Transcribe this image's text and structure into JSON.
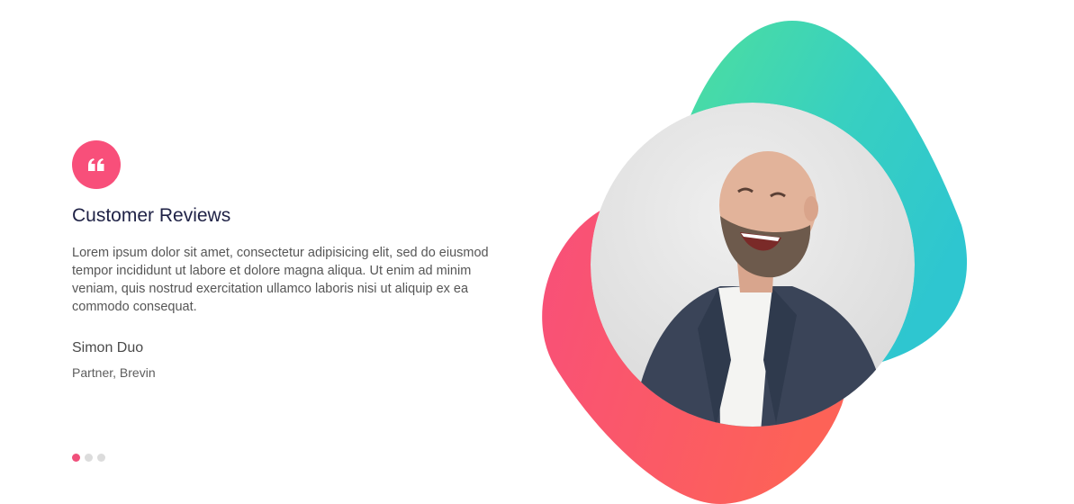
{
  "review": {
    "title": "Customer Reviews",
    "text": "Lorem ipsum dolor sit amet, consectetur adipisicing elit, sed do eiusmod tempor incididunt ut labore et dolore magna aliqua. Ut enim ad minim veniam, quis nostrud exercitation ullamco laboris nisi ut aliquip ex ea commodo consequat.",
    "author_name": "Simon Duo",
    "author_role": "Partner, Brevin"
  },
  "quote_icon": "quote-icon",
  "pagination": {
    "count": 3,
    "active_index": 0
  },
  "colors": {
    "accent": "#f84f7a",
    "title": "#1f2246",
    "teal_blob_start": "#4fe09b",
    "teal_blob_end": "#2ec6d0",
    "pink_blob_start": "#f84f7a",
    "pink_blob_end": "#fd6257",
    "dot_inactive": "#dcdcdc"
  }
}
